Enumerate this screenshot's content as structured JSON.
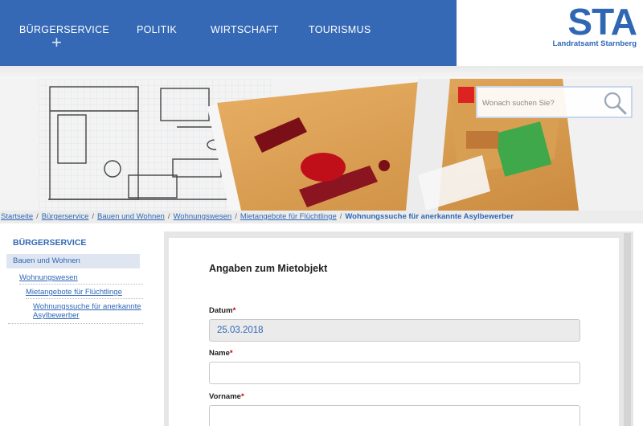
{
  "nav": {
    "items": [
      "BÜRGERSERVICE",
      "POLITIK",
      "WIRTSCHAFT",
      "TOURISMUS"
    ],
    "expand_symbol": "+"
  },
  "logo": {
    "mark": "STA",
    "subtitle": "Landratsamt Starnberg"
  },
  "search": {
    "placeholder": "Wonach suchen Sie?"
  },
  "breadcrumb": {
    "items": [
      "Startseite",
      "Bürgerservice",
      "Bauen und Wohnen",
      "Wohnungswesen",
      "Mietangebote für Flüchtlinge"
    ],
    "current": "Wohnungssuche für anerkannte Asylbewerber",
    "separator": "/"
  },
  "sidebar": {
    "title": "BÜRGERSERVICE",
    "active": "Bauen und Wohnen",
    "level2": "Wohnungswesen",
    "level3": "Mietangebote für Flüchtlinge",
    "level4_line1": "Wohnungssuche für anerkannte",
    "level4_line2": "Asylbewerber"
  },
  "form": {
    "section_title": "Angaben zum Mietobjekt",
    "datum_label": "Datum",
    "datum_value": "25.03.2018",
    "name_label": "Name",
    "name_value": "",
    "vorname_label": "Vorname",
    "vorname_value": "",
    "required_mark": "*"
  },
  "colors": {
    "brand_blue": "#3569b6",
    "link_blue": "#2f67b5",
    "required_red": "#cc0000"
  }
}
